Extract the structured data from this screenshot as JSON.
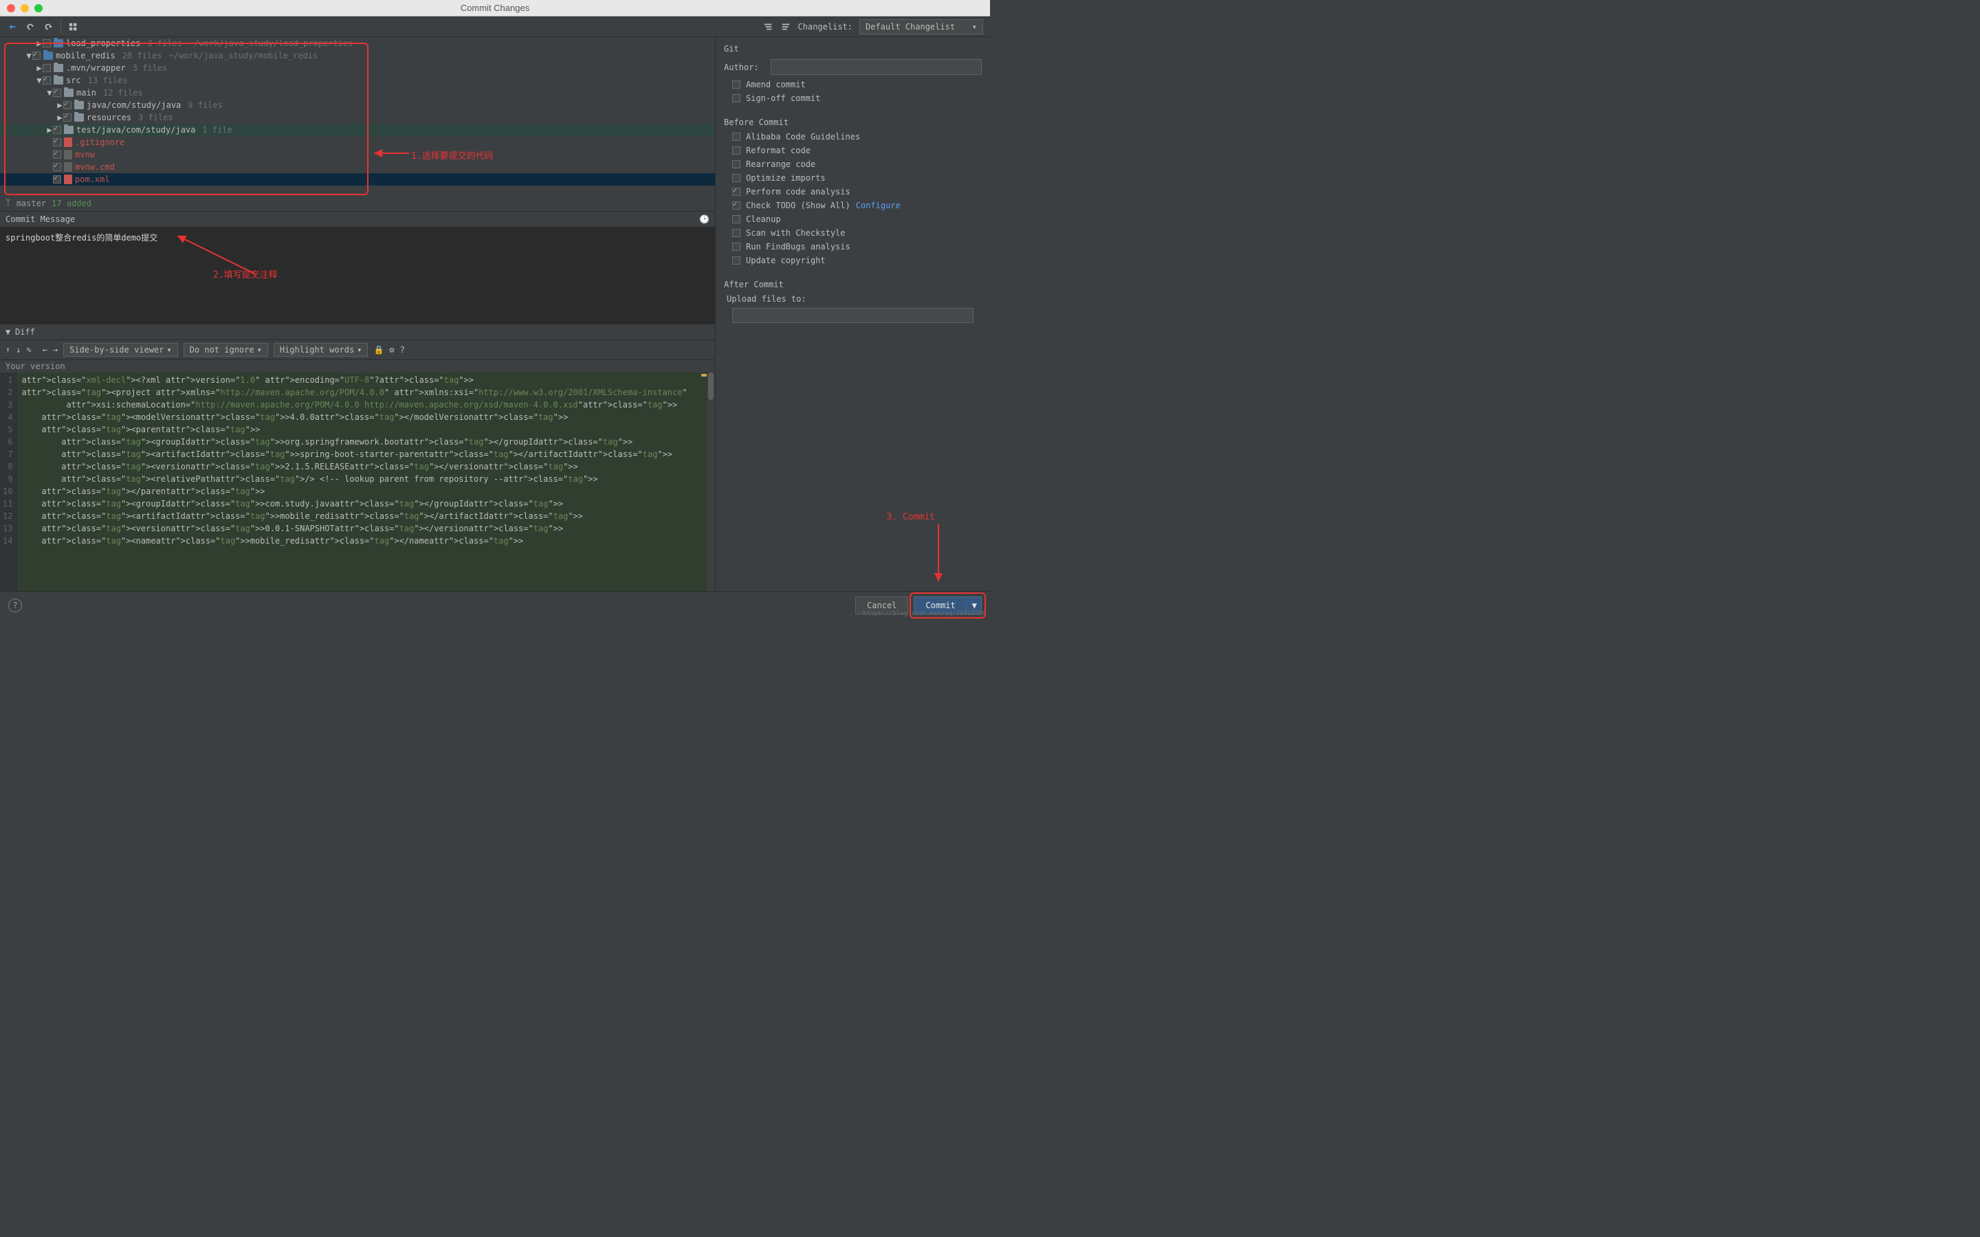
{
  "window": {
    "title": "Commit Changes"
  },
  "toolbar": {
    "changelist_label": "Changelist:",
    "changelist_value": "Default Changelist"
  },
  "tree": {
    "rows": [
      {
        "indent": 2,
        "exp": "▶",
        "chk": false,
        "module": true,
        "name": "load_properties",
        "meta": "3 files",
        "path": "~/work/java_study/load_properties",
        "red": false
      },
      {
        "indent": 1,
        "exp": "▼",
        "chk": true,
        "module": true,
        "name": "mobile_redis",
        "meta": "20 files",
        "path": "~/work/java_study/mobile_redis",
        "red": false
      },
      {
        "indent": 2,
        "exp": "▶",
        "chk": false,
        "folder": true,
        "name": ".mvn/wrapper",
        "meta": "3 files",
        "red": false
      },
      {
        "indent": 2,
        "exp": "▼",
        "chk": true,
        "folder": true,
        "name": "src",
        "meta": "13 files",
        "red": false
      },
      {
        "indent": 3,
        "exp": "▼",
        "chk": true,
        "folder": true,
        "name": "main",
        "meta": "12 files",
        "red": false
      },
      {
        "indent": 4,
        "exp": "▶",
        "chk": true,
        "folder": true,
        "name": "java/com/study/java",
        "meta": "9 files",
        "red": false
      },
      {
        "indent": 4,
        "exp": "▶",
        "chk": true,
        "folder": true,
        "name": "resources",
        "meta": "3 files",
        "red": false
      },
      {
        "indent": 3,
        "exp": "▶",
        "chk": true,
        "folder": true,
        "name": "test/java/com/study/java",
        "meta": "1 file",
        "red": false,
        "hl": true
      },
      {
        "indent": 3,
        "exp": "",
        "chk": true,
        "file": "gitignore",
        "name": ".gitignore",
        "red": true
      },
      {
        "indent": 3,
        "exp": "",
        "chk": true,
        "file": "sh",
        "name": "mvnw",
        "red": true
      },
      {
        "indent": 3,
        "exp": "",
        "chk": true,
        "file": "sh",
        "name": "mvnw.cmd",
        "red": true
      },
      {
        "indent": 3,
        "exp": "",
        "chk": true,
        "file": "xml",
        "name": "pom.xml",
        "red": true,
        "selected": true
      }
    ],
    "branch": "master",
    "status": "17 added"
  },
  "commit_message": {
    "header": "Commit Message",
    "text": "springboot整合redis的简单demo提交"
  },
  "diff": {
    "label": "Diff",
    "viewer": "Side-by-side viewer",
    "ignore": "Do not ignore",
    "highlight": "Highlight words",
    "your_version": "Your version"
  },
  "right": {
    "git": "Git",
    "author_label": "Author:",
    "amend": "Amend commit",
    "signoff": "Sign-off commit",
    "before": "Before Commit",
    "opts": [
      {
        "label": "Alibaba Code Guidelines",
        "on": false
      },
      {
        "label": "Reformat code",
        "on": false
      },
      {
        "label": "Rearrange code",
        "on": false
      },
      {
        "label": "Optimize imports",
        "on": false
      },
      {
        "label": "Perform code analysis",
        "on": true
      },
      {
        "label": "Check TODO (Show All)",
        "on": true,
        "link": "Configure"
      },
      {
        "label": "Cleanup",
        "on": false
      },
      {
        "label": "Scan with Checkstyle",
        "on": false
      },
      {
        "label": "Run FindBugs analysis",
        "on": false
      },
      {
        "label": "Update copyright",
        "on": false
      }
    ],
    "after": "After Commit",
    "upload": "Upload files to:"
  },
  "footer": {
    "cancel": "Cancel",
    "commit": "Commit"
  },
  "annotations": {
    "a1": "1.选择要提交的代码",
    "a2": "2.填写提交注释",
    "a3": "3. Commit"
  },
  "watermark": "https://blog.csdn.net/qq_36522306",
  "code": {
    "lines": [
      "<?xml version=\"1.0\" encoding=\"UTF-8\"?>",
      "<project xmlns=\"http://maven.apache.org/POM/4.0.0\" xmlns:xsi=\"http://www.w3.org/2001/XMLSchema-instance\"",
      "         xsi:schemaLocation=\"http://maven.apache.org/POM/4.0.0 http://maven.apache.org/xsd/maven-4.0.0.xsd\">",
      "    <modelVersion>4.0.0</modelVersion>",
      "    <parent>",
      "        <groupId>org.springframework.boot</groupId>",
      "        <artifactId>spring-boot-starter-parent</artifactId>",
      "        <version>2.1.5.RELEASE</version>",
      "        <relativePath/> <!-- lookup parent from repository -->",
      "    </parent>",
      "    <groupId>com.study.java</groupId>",
      "    <artifactId>mobile_redis</artifactId>",
      "    <version>0.0.1-SNAPSHOT</version>",
      "    <name>mobile_redis</name>"
    ]
  }
}
